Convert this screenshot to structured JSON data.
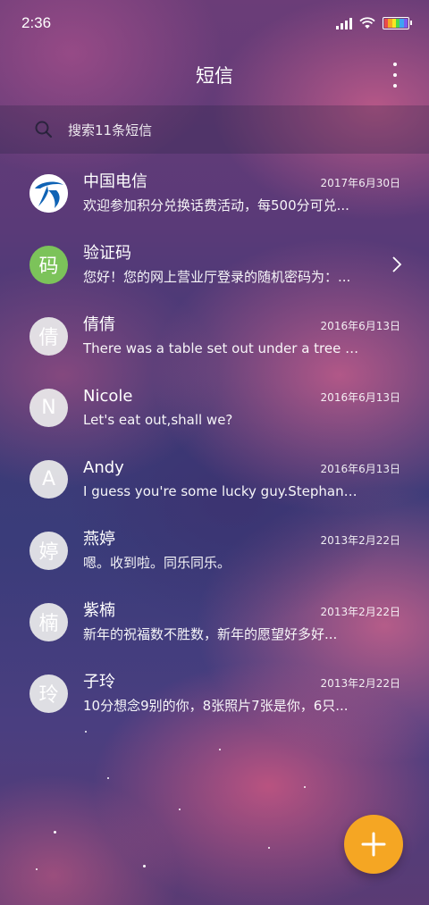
{
  "status_bar": {
    "time": "2:36",
    "icons": [
      "signal-icon",
      "wifi-icon",
      "battery-icon"
    ]
  },
  "app_bar": {
    "title": "短信",
    "menu_icon": "more-vertical-icon"
  },
  "search": {
    "icon": "search-icon",
    "placeholder": "搜索11条短信"
  },
  "conversations": [
    {
      "avatar_type": "telecom-logo",
      "avatar_text": "",
      "name": "中国电信",
      "date": "2017年6月30日",
      "preview": "欢迎参加积分兑换话费活动，每500分可兑..."
    },
    {
      "avatar_type": "green",
      "avatar_text": "码",
      "name": "验证码",
      "date": "",
      "preview": "您好！您的网上营业厅登录的随机密码为：...",
      "chevron": "chevron-right-icon"
    },
    {
      "avatar_type": "default",
      "avatar_text": "倩",
      "name": "倩倩",
      "date": "2016年6月13日",
      "preview": "There was a table set out under a tree in..."
    },
    {
      "avatar_type": "default",
      "avatar_text": "N",
      "name": "Nicole",
      "date": "2016年6月13日",
      "preview": "Let's eat out,shall we?"
    },
    {
      "avatar_type": "default",
      "avatar_text": "A",
      "name": "Andy",
      "date": "2016年6月13日",
      "preview": "I guess you're some lucky guy.Stephani..."
    },
    {
      "avatar_type": "default",
      "avatar_text": "婷",
      "name": "燕婷",
      "date": "2013年2月22日",
      "preview": "嗯。收到啦。同乐同乐。"
    },
    {
      "avatar_type": "default",
      "avatar_text": "楠",
      "name": "紫楠",
      "date": "2013年2月22日",
      "preview": "新年的祝福数不胜数，新年的愿望好多好..."
    },
    {
      "avatar_type": "default",
      "avatar_text": "玲",
      "name": "子玲",
      "date": "2013年2月22日",
      "preview": "10分想念9别的你，8张照片7张是你，6只..."
    }
  ],
  "fab": {
    "icon": "plus-icon"
  },
  "colors": {
    "fab": "#f5a623",
    "verify_avatar": "#7cc35a",
    "telecom_blue": "#0f63b5"
  }
}
